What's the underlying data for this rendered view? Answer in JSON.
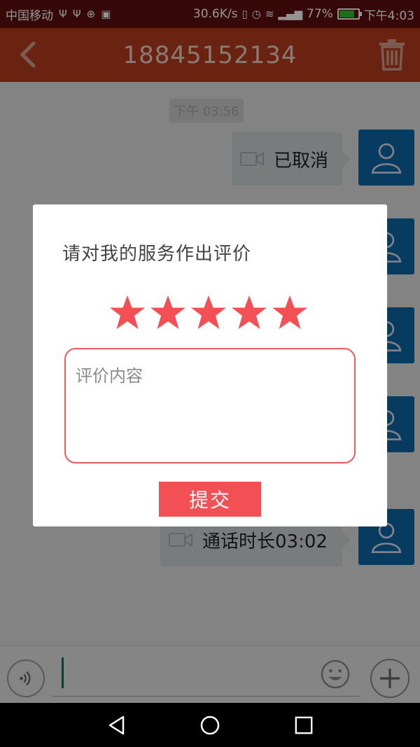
{
  "status_bar": {
    "carrier": "中国移动",
    "speed": "30.6K/s",
    "battery": "77%",
    "battery_level": 0.77,
    "time": "下午4:03"
  },
  "header": {
    "title": "18845152134",
    "back_icon": "chevron-left-icon",
    "delete_icon": "trash-icon"
  },
  "chat": {
    "time_divider": "下午 03:56",
    "messages": [
      {
        "text": "已取消",
        "icon": "video-camera-icon"
      },
      {
        "text": "通话时长03:02",
        "icon": "video-camera-icon"
      }
    ]
  },
  "dialog": {
    "title": "请对我的服务作出评价",
    "rating": 5,
    "rating_max": 5,
    "review_placeholder": "评价内容",
    "submit_label": "提交",
    "accent": "#f25054"
  },
  "input_bar": {
    "voice_icon": "voice-icon",
    "emoji_icon": "emoji-icon",
    "plus_icon": "plus-icon"
  },
  "nav": {
    "back_icon": "nav-back-icon",
    "home_icon": "nav-home-icon",
    "recents_icon": "nav-recents-icon"
  }
}
